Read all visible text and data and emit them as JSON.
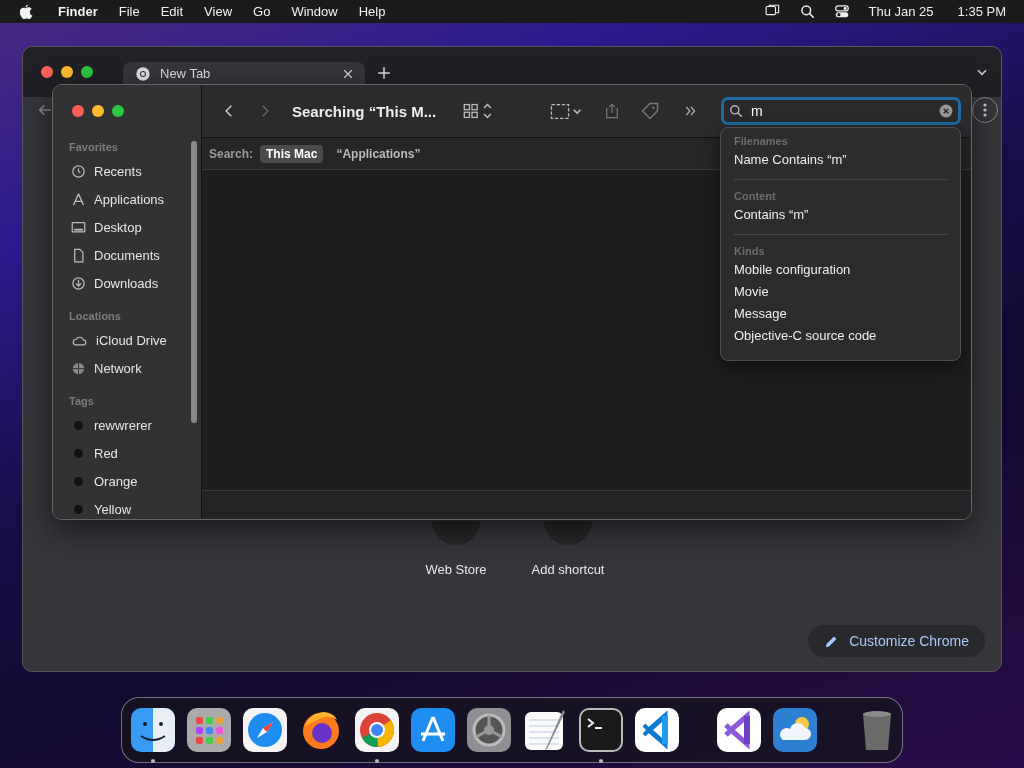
{
  "menu_bar": {
    "app": "Finder",
    "menus": [
      "File",
      "Edit",
      "View",
      "Go",
      "Window",
      "Help"
    ],
    "date": "Thu Jan 25",
    "time": "1:35 PM"
  },
  "chrome": {
    "tab": {
      "title": "New Tab",
      "selected": true
    },
    "shortcuts": [
      {
        "label": "Web Store"
      },
      {
        "label": "Add shortcut"
      }
    ],
    "customize_button": "Customize Chrome"
  },
  "finder": {
    "title": "Searching “This M...",
    "search_field": {
      "value": "m"
    },
    "scope": {
      "label": "Search:",
      "options": [
        {
          "label": "This Mac",
          "selected": true
        },
        {
          "label": "“Applications”",
          "selected": false
        }
      ]
    },
    "sidebar": {
      "sections": [
        {
          "heading": "Favorites",
          "items": [
            {
              "label": "Recents"
            },
            {
              "label": "Applications"
            },
            {
              "label": "Desktop"
            },
            {
              "label": "Documents"
            },
            {
              "label": "Downloads"
            }
          ]
        },
        {
          "heading": "Locations",
          "items": [
            {
              "label": "iCloud Drive"
            },
            {
              "label": "Network"
            }
          ]
        },
        {
          "heading": "Tags",
          "items": [
            {
              "label": "rewwrerer",
              "color": "#111111"
            },
            {
              "label": "Red",
              "color": "#111111"
            },
            {
              "label": "Orange",
              "color": "#111111"
            },
            {
              "label": "Yellow",
              "color": "#111111"
            }
          ]
        }
      ]
    },
    "suggestions": [
      {
        "heading": "Filenames",
        "items": [
          "Name Contains “m”"
        ]
      },
      {
        "heading": "Content",
        "items": [
          "Contains “m”"
        ]
      },
      {
        "heading": "Kinds",
        "items": [
          "Mobile configuration",
          "Movie",
          "Message",
          "Objective-C source code"
        ]
      }
    ]
  },
  "dock": {
    "items": [
      {
        "running": true
      },
      {
        "running": false
      },
      {
        "running": false
      },
      {
        "running": false
      },
      {
        "running": true
      },
      {
        "running": false
      },
      {
        "running": false
      },
      {
        "running": false
      },
      {
        "running": true
      },
      {
        "running": false
      },
      {
        "running": false
      },
      {
        "running": false
      },
      {
        "running": false
      }
    ]
  }
}
